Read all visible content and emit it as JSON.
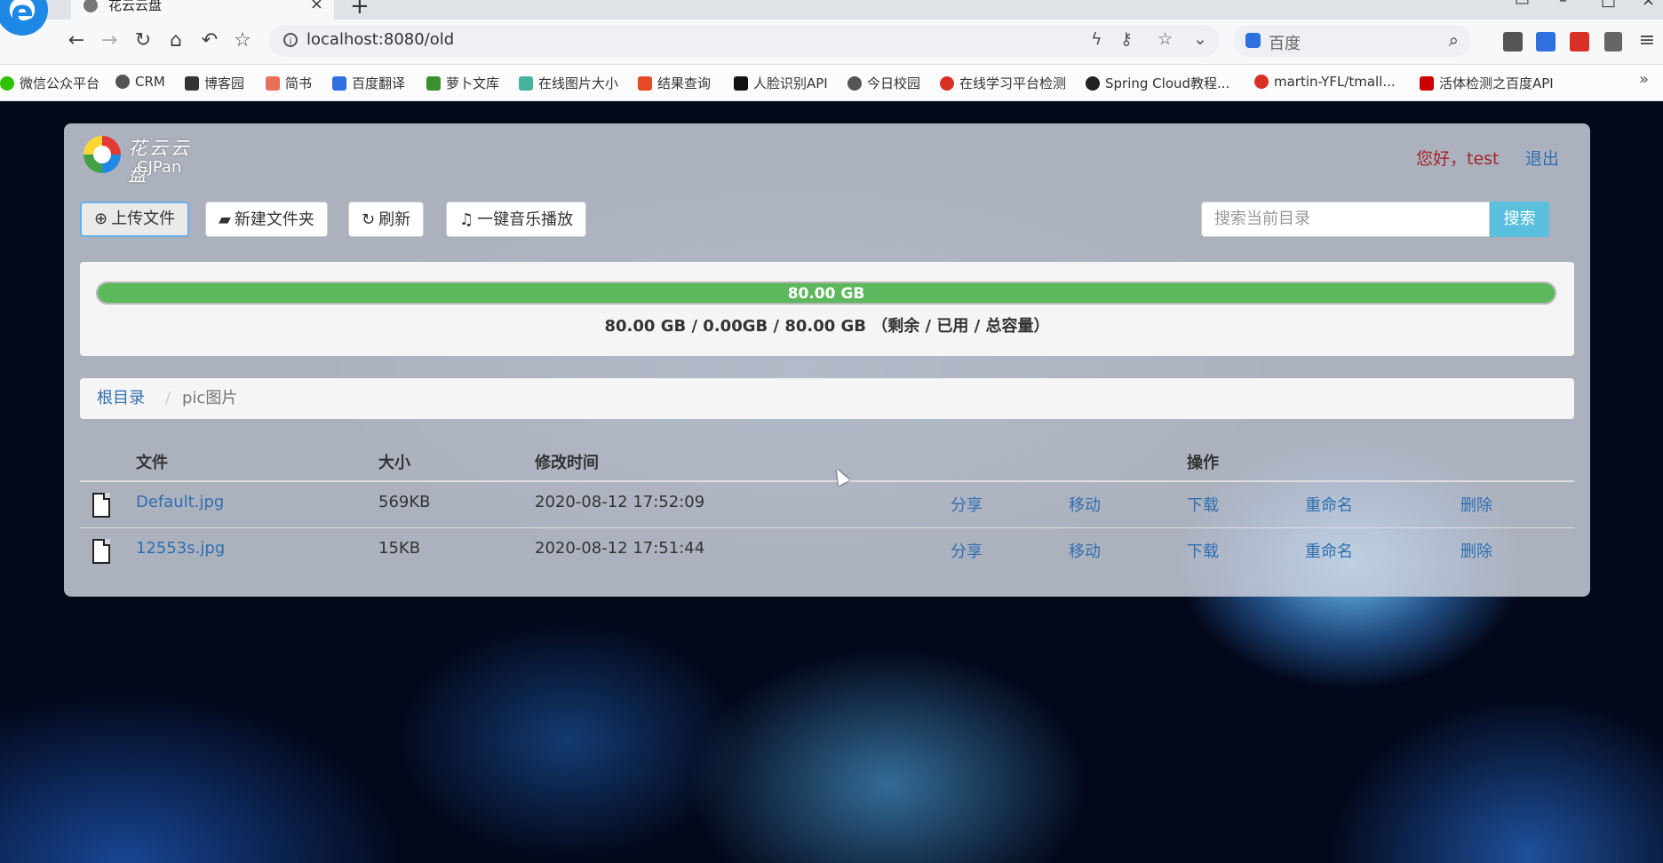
{
  "browser": {
    "tab_title": "花云云盘",
    "url": "localhost:8080/old",
    "search_engine": "百度"
  },
  "bookmarks": [
    {
      "label": "微信公众平台",
      "icon": "wechat-icon",
      "color": "#2dc100"
    },
    {
      "label": "CRM",
      "icon": "globe-icon",
      "color": "#555555"
    },
    {
      "label": "博客园",
      "icon": "blog-icon",
      "color": "#333333"
    },
    {
      "label": "简书",
      "icon": "jianshu-icon",
      "color": "#ea6f5a"
    },
    {
      "label": "百度翻译",
      "icon": "translate-icon",
      "color": "#2f6fe0"
    },
    {
      "label": "萝卜文库",
      "icon": "carrot-icon",
      "color": "#3a8f2f"
    },
    {
      "label": "在线图片大小",
      "icon": "gear-icon",
      "color": "#44b49c"
    },
    {
      "label": "结果查询",
      "icon": "html5-icon",
      "color": "#e34c26"
    },
    {
      "label": "人脸识别API",
      "icon": "ai-icon",
      "color": "#111111"
    },
    {
      "label": "今日校园",
      "icon": "globe-icon",
      "color": "#555555"
    },
    {
      "label": "在线学习平台检测",
      "icon": "g-icon",
      "color": "#d93025"
    },
    {
      "label": "Spring Cloud教程...",
      "icon": "github-icon",
      "color": "#222222"
    },
    {
      "label": "martin-YFL/tmall...",
      "icon": "g-icon",
      "color": "#d93025"
    },
    {
      "label": "活体检测之百度API",
      "icon": "c-icon",
      "color": "#cc0000"
    }
  ],
  "app": {
    "logo_cn": "花云云盘",
    "logo_en": "CJPan",
    "greeting": "您好，test",
    "logout": "退出"
  },
  "toolbar": {
    "upload": "上传文件",
    "new_folder": "新建文件夹",
    "refresh": "刷新",
    "music": "一键音乐播放",
    "search_placeholder": "搜索当前目录",
    "search_button": "搜索"
  },
  "storage": {
    "progress_label": "80.00 GB",
    "progress_fraction": 1.0,
    "summary": "80.00 GB / 0.00GB / 80.00 GB （剩余 / 已用 / 总容量）"
  },
  "breadcrumb": {
    "root": "根目录",
    "separator": "/",
    "current": "pic图片"
  },
  "table": {
    "headers": {
      "file": "文件",
      "size": "大小",
      "modified": "修改时间",
      "actions": "操作"
    },
    "rows": [
      {
        "name": "Default.jpg",
        "size": "569KB",
        "modified": "2020-08-12 17:52:09",
        "share": "分享",
        "move": "移动",
        "download": "下载",
        "rename": "重命名",
        "delete": "删除"
      },
      {
        "name": "12553s.jpg",
        "size": "15KB",
        "modified": "2020-08-12 17:51:44",
        "share": "分享",
        "move": "移动",
        "download": "下载",
        "rename": "重命名",
        "delete": "删除"
      }
    ]
  },
  "colors": {
    "progress": "#5cb85c",
    "search_button": "#5bc0de",
    "link": "#2f6fb0",
    "greeting": "#a3262a"
  }
}
